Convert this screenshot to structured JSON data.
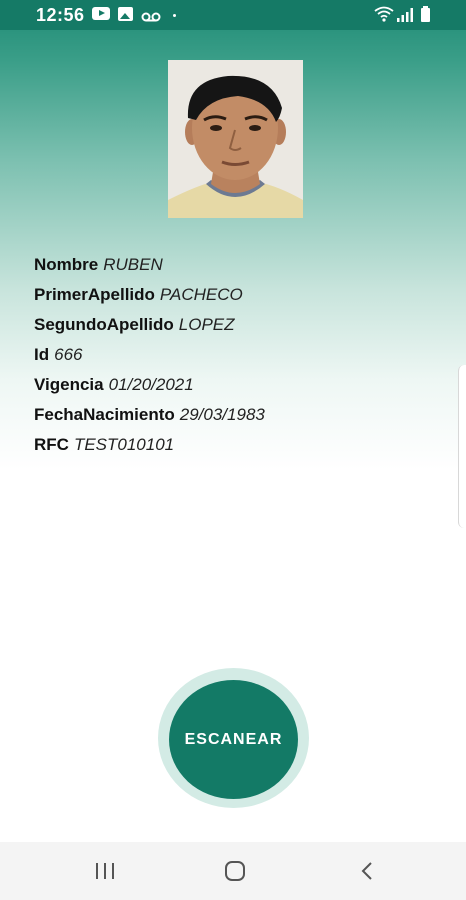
{
  "status_bar": {
    "time": "12:56",
    "icons": [
      "youtube-icon",
      "image-icon",
      "voicemail-icon",
      "dot-icon",
      "wifi-icon",
      "signal-icon",
      "battery-icon"
    ]
  },
  "profile": {
    "photo": "person-photo",
    "fields": [
      {
        "label": "Nombre",
        "value": "RUBEN"
      },
      {
        "label": "PrimerApellido",
        "value": "PACHECO"
      },
      {
        "label": "SegundoApellido",
        "value": "LOPEZ"
      },
      {
        "label": "Id",
        "value": "666"
      },
      {
        "label": "Vigencia",
        "value": "01/20/2021"
      },
      {
        "label": "FechaNacimiento",
        "value": "29/03/1983"
      },
      {
        "label": "RFC",
        "value": "TEST010101"
      }
    ]
  },
  "actions": {
    "scan_label": "ESCANEAR"
  },
  "nav_bar": {
    "icons": [
      "recents-icon",
      "home-icon",
      "back-icon"
    ]
  },
  "colors": {
    "primary": "#137a66",
    "status_bar": "#157a66",
    "ring": "#d3ebe5",
    "nav_bar": "#f4f4f4"
  }
}
